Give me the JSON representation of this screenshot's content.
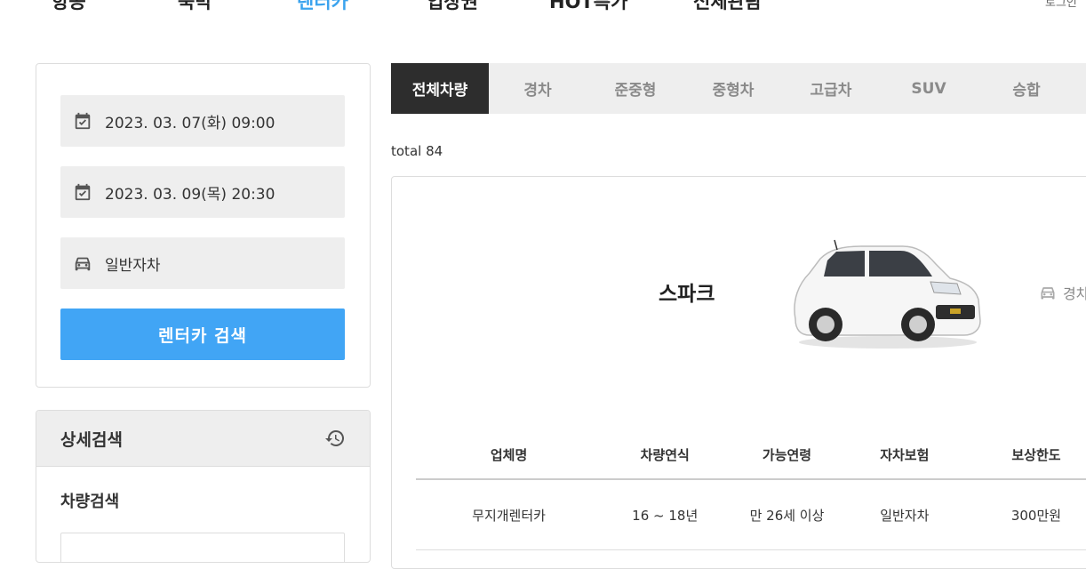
{
  "top_nav": {
    "items": [
      "항공",
      "숙박",
      "렌터카",
      "입장권",
      "HOT특가",
      "전체관람"
    ],
    "active_index": 2,
    "login_label": "로그인"
  },
  "search": {
    "pickup_datetime": "2023. 03. 07(화) 09:00",
    "return_datetime": "2023. 03. 09(목) 20:30",
    "car_category": "일반자차",
    "search_button_label": "렌터카 검색"
  },
  "detail_search": {
    "title": "상세검색",
    "section_title": "차량검색",
    "input_value": ""
  },
  "tabs": [
    "전체차량",
    "경차",
    "준중형",
    "중형차",
    "고급차",
    "SUV",
    "승합"
  ],
  "active_tab_index": 0,
  "total_label": "total 84",
  "result": {
    "car_name": "스파크",
    "car_type": "경차",
    "table": {
      "headers": [
        "업체명",
        "차량연식",
        "가능연령",
        "자차보험",
        "보상한도"
      ],
      "rows": [
        [
          "무지개렌터카",
          "16 ~ 18년",
          "만 26세 이상",
          "일반자차",
          "300만원"
        ]
      ]
    }
  },
  "colors": {
    "accent": "#41a5f5",
    "active_nav": "#3aa3ee",
    "tab_active_bg": "#2d2d2d",
    "field_bg": "#eeeeee"
  }
}
